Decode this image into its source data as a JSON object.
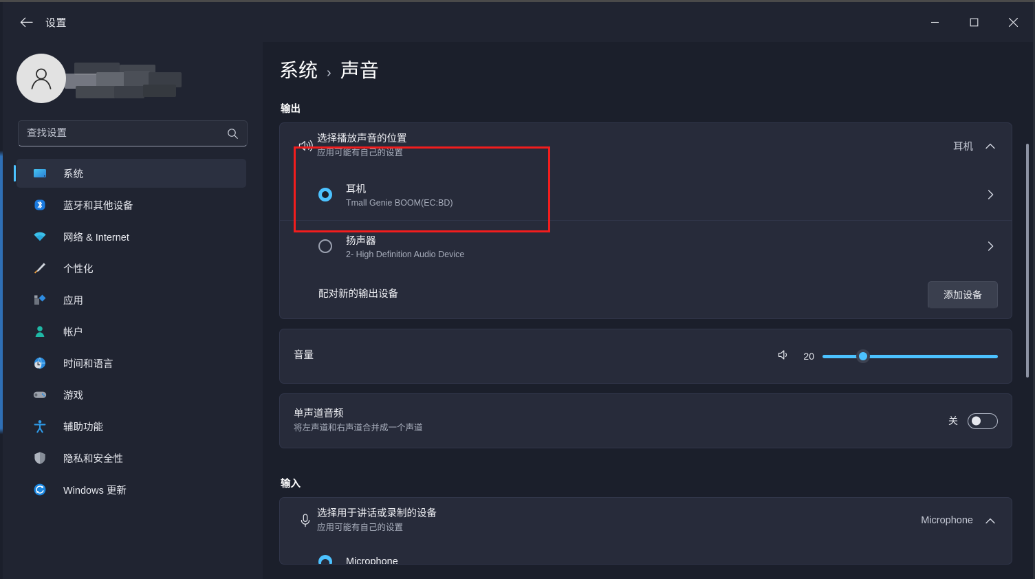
{
  "window": {
    "app_title": "设置",
    "back_icon": "back-arrow-icon",
    "minimize_label": "—",
    "maximize_label": "□",
    "close_label": "✕"
  },
  "sidebar": {
    "account_name_hidden": "",
    "search": {
      "placeholder": "查找设置",
      "value": "",
      "icon": "search-icon"
    },
    "items": [
      {
        "label": "系统",
        "icon": "system-icon",
        "active": true
      },
      {
        "label": "蓝牙和其他设备",
        "icon": "bluetooth-icon",
        "active": false
      },
      {
        "label": "网络 & Internet",
        "icon": "network-icon",
        "active": false
      },
      {
        "label": "个性化",
        "icon": "personalization-icon",
        "active": false
      },
      {
        "label": "应用",
        "icon": "apps-icon",
        "active": false
      },
      {
        "label": "帐户",
        "icon": "accounts-icon",
        "active": false
      },
      {
        "label": "时间和语言",
        "icon": "time-language-icon",
        "active": false
      },
      {
        "label": "游戏",
        "icon": "gaming-icon",
        "active": false
      },
      {
        "label": "辅助功能",
        "icon": "accessibility-icon",
        "active": false
      },
      {
        "label": "隐私和安全性",
        "icon": "privacy-security-icon",
        "active": false
      },
      {
        "label": "Windows 更新",
        "icon": "windows-update-icon",
        "active": false
      }
    ]
  },
  "breadcrumb": {
    "parent": "系统",
    "separator": "›",
    "current": "声音"
  },
  "output_section": {
    "title": "输出",
    "chooser": {
      "icon": "speaker-icon",
      "title": "选择播放声音的位置",
      "subtitle": "应用可能有自己的设置",
      "value": "耳机",
      "expand_icon": "chevron-up-icon"
    },
    "devices": [
      {
        "name": "耳机",
        "detail": "Tmall Genie BOOM(EC:BD)",
        "selected": true,
        "chevron": "chevron-right-icon"
      },
      {
        "name": "扬声器",
        "detail": "2- High Definition Audio Device",
        "selected": false,
        "chevron": "chevron-right-icon"
      }
    ],
    "pair": {
      "title": "配对新的输出设备",
      "button_label": "添加设备"
    },
    "volume": {
      "title": "音量",
      "icon": "volume-icon",
      "value": "20",
      "percent": 23,
      "min": 0,
      "max": 100
    },
    "mono": {
      "title": "单声道音频",
      "subtitle": "将左声道和右声道合并成一个声道",
      "state_label": "关",
      "enabled": false
    }
  },
  "input_section": {
    "title": "输入",
    "chooser": {
      "icon": "microphone-icon",
      "title": "选择用于讲话或录制的设备",
      "subtitle": "应用可能有自己的设置",
      "value": "Microphone",
      "expand_icon": "chevron-up-icon"
    },
    "partial_device": {
      "name": "Microphone"
    }
  },
  "annotation": {
    "color": "#f21d1d",
    "target": "耳机"
  },
  "colors": {
    "accent": "#4cc2ff",
    "window_bg": "#1b1f2b",
    "sidebar_bg": "#202431",
    "card_bg": "#272b3a",
    "annotation": "#f21d1d"
  }
}
